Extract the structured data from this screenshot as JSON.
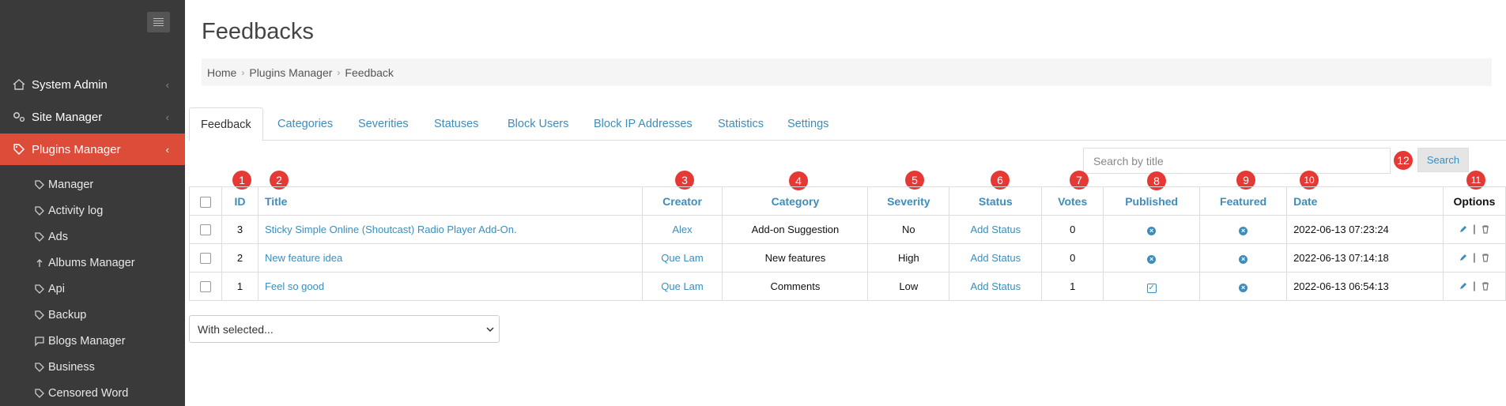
{
  "sidebar": {
    "main": [
      {
        "label": "System Admin",
        "icon": "home-icon",
        "chevron": "‹"
      },
      {
        "label": "Site Manager",
        "icon": "gears-icon",
        "chevron": "‹"
      },
      {
        "label": "Plugins Manager",
        "icon": "tag-icon",
        "chevron": "‹",
        "active": true
      }
    ],
    "sub": [
      {
        "label": "Manager",
        "icon": "tag-icon"
      },
      {
        "label": "Activity log",
        "icon": "tag-icon"
      },
      {
        "label": "Ads",
        "icon": "tag-icon"
      },
      {
        "label": "Albums Manager",
        "icon": "upload-icon"
      },
      {
        "label": "Api",
        "icon": "tag-icon"
      },
      {
        "label": "Backup",
        "icon": "tag-icon"
      },
      {
        "label": "Blogs Manager",
        "icon": "comment-icon"
      },
      {
        "label": "Business",
        "icon": "tag-icon"
      },
      {
        "label": "Censored Word",
        "icon": "tag-icon"
      }
    ]
  },
  "page": {
    "title": "Feedbacks",
    "breadcrumb": [
      "Home",
      "Plugins Manager",
      "Feedback"
    ],
    "breadcrumb_sep": "›"
  },
  "tabs": [
    "Feedback",
    "Categories",
    "Severities",
    "Statuses",
    "Block Users",
    "Block IP Addresses",
    "Statistics",
    "Settings"
  ],
  "search": {
    "placeholder": "Search by title",
    "button": "Search"
  },
  "badges": [
    "1",
    "2",
    "3",
    "4",
    "5",
    "6",
    "7",
    "8",
    "9",
    "10",
    "11",
    "12"
  ],
  "table": {
    "headers": {
      "id": "ID",
      "title": "Title",
      "creator": "Creator",
      "category": "Category",
      "severity": "Severity",
      "status": "Status",
      "votes": "Votes",
      "published": "Published",
      "featured": "Featured",
      "date": "Date",
      "options": "Options"
    },
    "rows": [
      {
        "id": "3",
        "title": "Sticky Simple Online (Shoutcast) Radio Player Add-On.",
        "creator": "Alex",
        "category": "Add-on Suggestion",
        "severity": "No",
        "status": "Add Status",
        "votes": "0",
        "published": "x-icon",
        "featured": "x-icon",
        "date": "2022-06-13 07:23:24"
      },
      {
        "id": "2",
        "title": "New feature idea",
        "creator": "Que Lam",
        "category": "New features",
        "severity": "High",
        "status": "Add Status",
        "votes": "0",
        "published": "x-icon",
        "featured": "x-icon",
        "date": "2022-06-13 07:14:18"
      },
      {
        "id": "1",
        "title": "Feel so good",
        "creator": "Que Lam",
        "category": "Comments",
        "severity": "Low",
        "status": "Add Status",
        "votes": "1",
        "published": "check-icon",
        "featured": "x-icon",
        "date": "2022-06-13 06:54:13"
      }
    ],
    "option_sep": "|"
  },
  "bulk": {
    "selected": "With selected..."
  },
  "colors": {
    "sidebar": "#3a3a3a",
    "active": "#dd4b39",
    "link": "#3c8dbc",
    "badge": "#e53935"
  }
}
